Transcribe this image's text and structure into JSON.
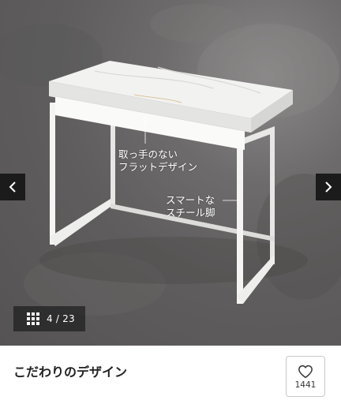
{
  "gallery": {
    "callouts": {
      "drawer_line1": "取っ手のない",
      "drawer_line2": "フラットデザイン",
      "legs_line1": "スマートな",
      "legs_line2": "スチール脚"
    },
    "counter": {
      "text": "4 / 23"
    },
    "prev_icon": "chevron-left-icon",
    "next_icon": "chevron-right-icon",
    "grid_icon": "grid-icon"
  },
  "product": {
    "title": "こだわりのデザイン"
  },
  "favorite": {
    "icon": "heart-icon",
    "count": "1441"
  },
  "colors": {
    "arrow_bg": "#1b1b1b",
    "counter_bg": "#1e1e1e",
    "desk_white": "#f2f2f0"
  }
}
